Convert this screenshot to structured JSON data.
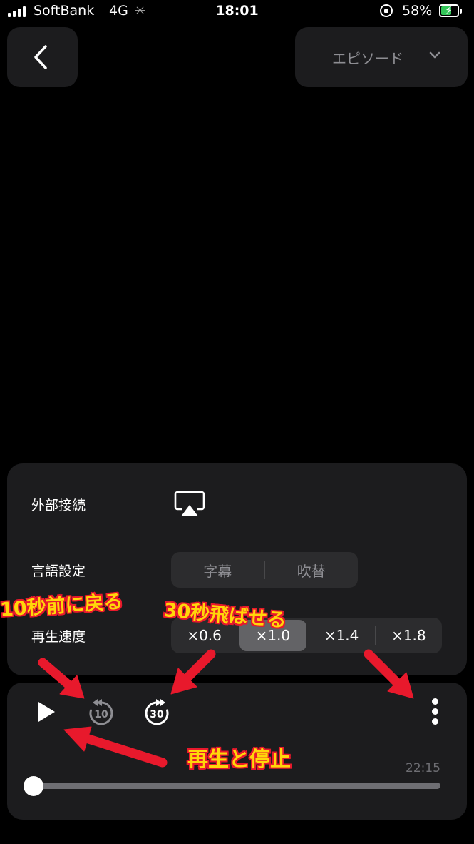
{
  "status_bar": {
    "carrier": "SoftBank",
    "network": "4G",
    "time": "18:01",
    "battery_percent": "58%",
    "battery_level": 0.58
  },
  "header": {
    "back_icon": "chevron-left-icon",
    "episode_label": "エピソード",
    "episode_icon": "chevron-down-icon"
  },
  "settings": {
    "external_label": "外部接続",
    "external_icon": "airplay-icon",
    "language_label": "言語設定",
    "language_options": [
      "字幕",
      "吹替"
    ],
    "speed_label": "再生速度",
    "speed_options": [
      "×0.6",
      "×1.0",
      "×1.4",
      "×1.8"
    ],
    "speed_selected": "×1.0"
  },
  "player": {
    "play_icon": "play-icon",
    "rewind_icon": "rewind-10-icon",
    "rewind_seconds": "10",
    "forward_icon": "forward-30-icon",
    "forward_seconds": "30",
    "more_icon": "more-vertical-icon",
    "duration": "22:15",
    "progress": 0
  },
  "annotations": {
    "rewind_note": "10秒前に戻る",
    "forward_note": "30秒飛ばせる",
    "play_note": "再生と停止",
    "color_text": "#ffd60a",
    "color_arrow": "#e8192c"
  }
}
